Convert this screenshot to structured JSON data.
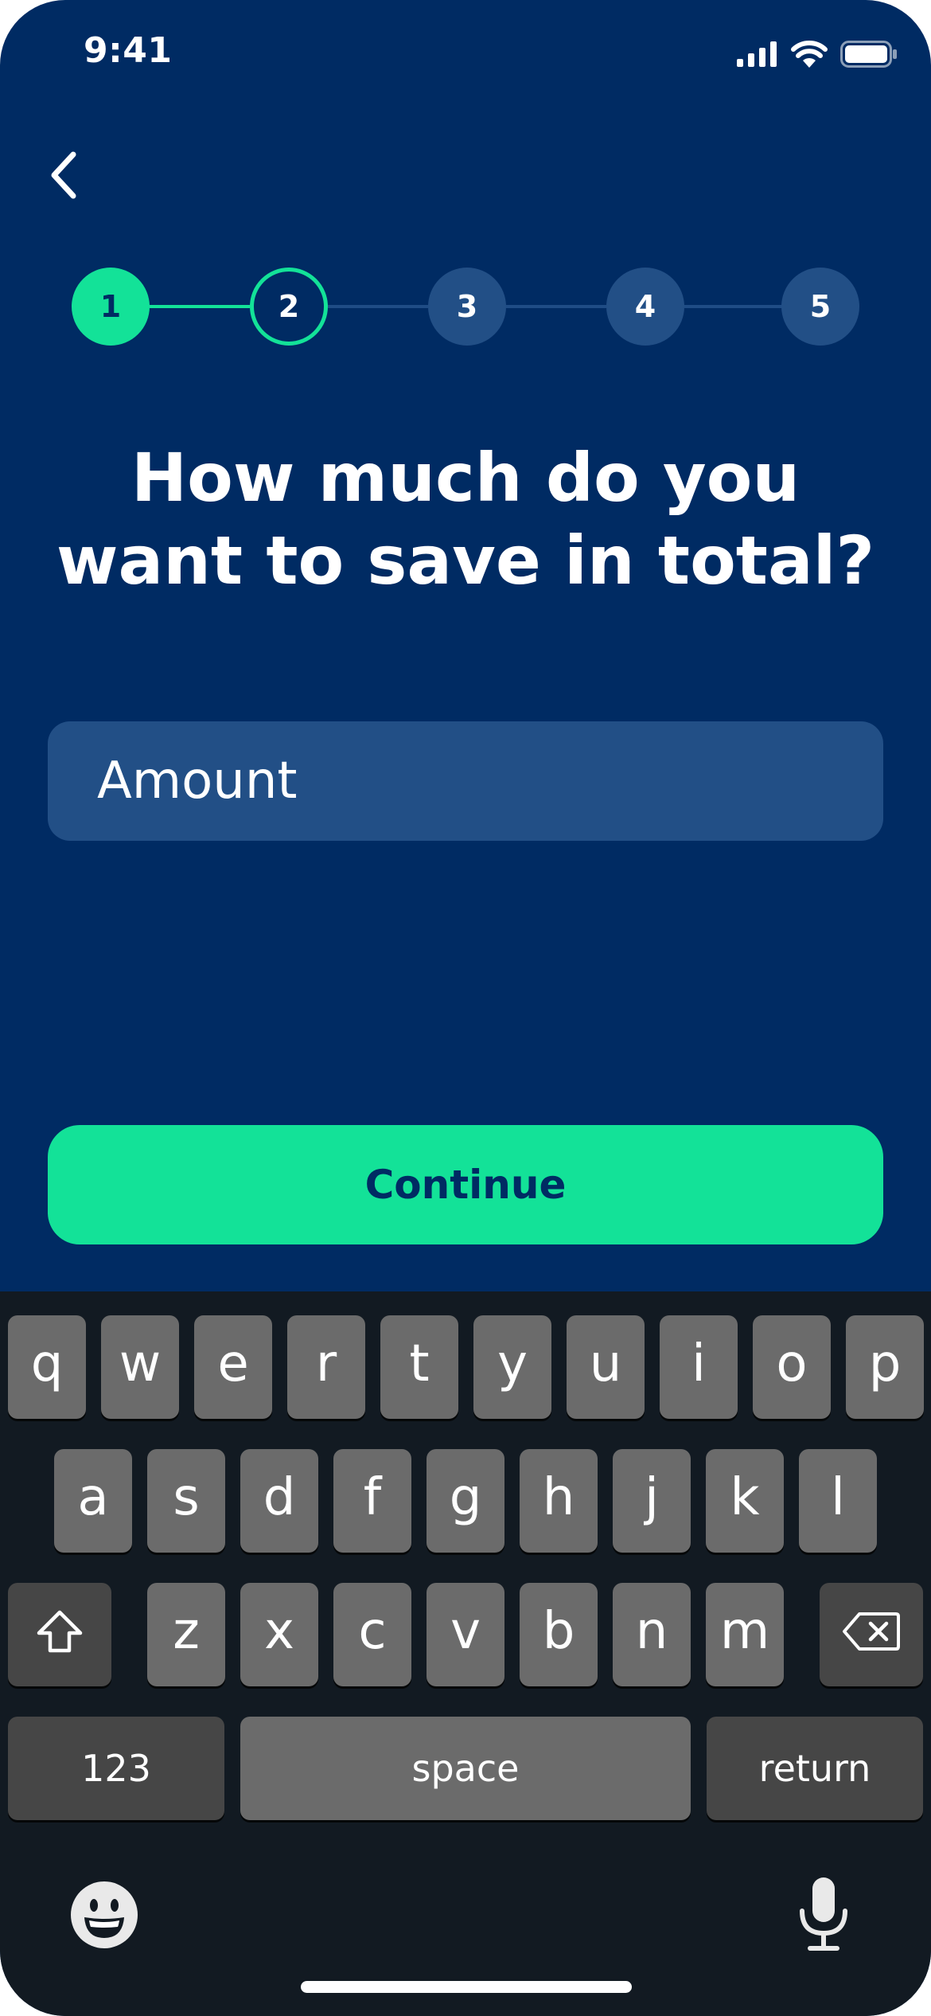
{
  "status_bar": {
    "time": "9:41",
    "icons": [
      "cellular-signal-icon",
      "wifi-icon",
      "battery-icon"
    ]
  },
  "navigation": {
    "back_icon": "chevron-left-icon"
  },
  "stepper": {
    "steps": [
      {
        "label": "1",
        "state": "completed"
      },
      {
        "label": "2",
        "state": "current"
      },
      {
        "label": "3",
        "state": "upcoming"
      },
      {
        "label": "4",
        "state": "upcoming"
      },
      {
        "label": "5",
        "state": "upcoming"
      }
    ]
  },
  "question": {
    "line1": "How much do you",
    "line2": "want to save in total?"
  },
  "amount_input": {
    "placeholder": "Amount",
    "value": ""
  },
  "continue_button": {
    "label": "Continue"
  },
  "keyboard": {
    "row1": [
      "q",
      "w",
      "e",
      "r",
      "t",
      "y",
      "u",
      "i",
      "o",
      "p"
    ],
    "row2": [
      "a",
      "s",
      "d",
      "f",
      "g",
      "h",
      "j",
      "k",
      "l"
    ],
    "row3": [
      "z",
      "x",
      "c",
      "v",
      "b",
      "n",
      "m"
    ],
    "numbers_key": "123",
    "space_key": "space",
    "return_key": "return",
    "shift_icon": "shift-icon",
    "delete_icon": "delete-icon",
    "emoji_icon": "emoji-icon",
    "mic_icon": "microphone-icon"
  },
  "colors": {
    "background": "#002b63",
    "accent": "#13e298",
    "field": "#224f86",
    "keyboard_background": "#121a22",
    "key": "#6b6b6b",
    "key_dark": "#464646"
  }
}
